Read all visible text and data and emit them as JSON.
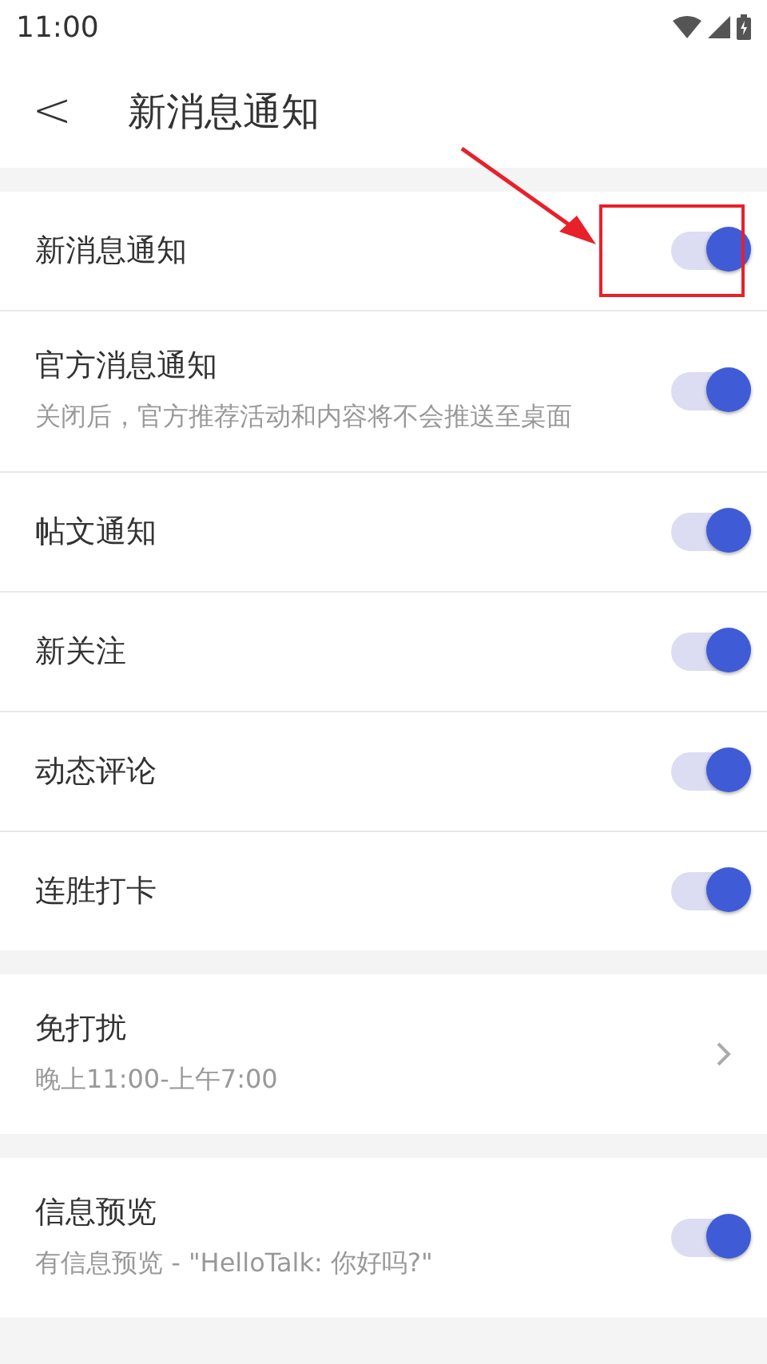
{
  "status_bar": {
    "time": "11:00"
  },
  "header": {
    "back": "<",
    "title": "新消息通知"
  },
  "sections": [
    {
      "rows": [
        {
          "kind": "toggle",
          "label": "新消息通知",
          "on": true,
          "highlighted": true
        },
        {
          "kind": "toggle",
          "label": "官方消息通知",
          "description": "关闭后，官方推荐活动和内容将不会推送至桌面",
          "on": true
        },
        {
          "kind": "toggle",
          "label": "帖文通知",
          "on": true
        },
        {
          "kind": "toggle",
          "label": "新关注",
          "on": true
        },
        {
          "kind": "toggle",
          "label": "动态评论",
          "on": true
        },
        {
          "kind": "toggle",
          "label": "连胜打卡",
          "on": true
        }
      ]
    },
    {
      "rows": [
        {
          "kind": "link",
          "label": "免打扰",
          "description": "晚上11:00-上午7:00"
        }
      ]
    },
    {
      "rows": [
        {
          "kind": "toggle",
          "label": "信息预览",
          "description": "有信息预览 - \"HelloTalk: 你好吗?\"",
          "on": true
        }
      ]
    }
  ]
}
